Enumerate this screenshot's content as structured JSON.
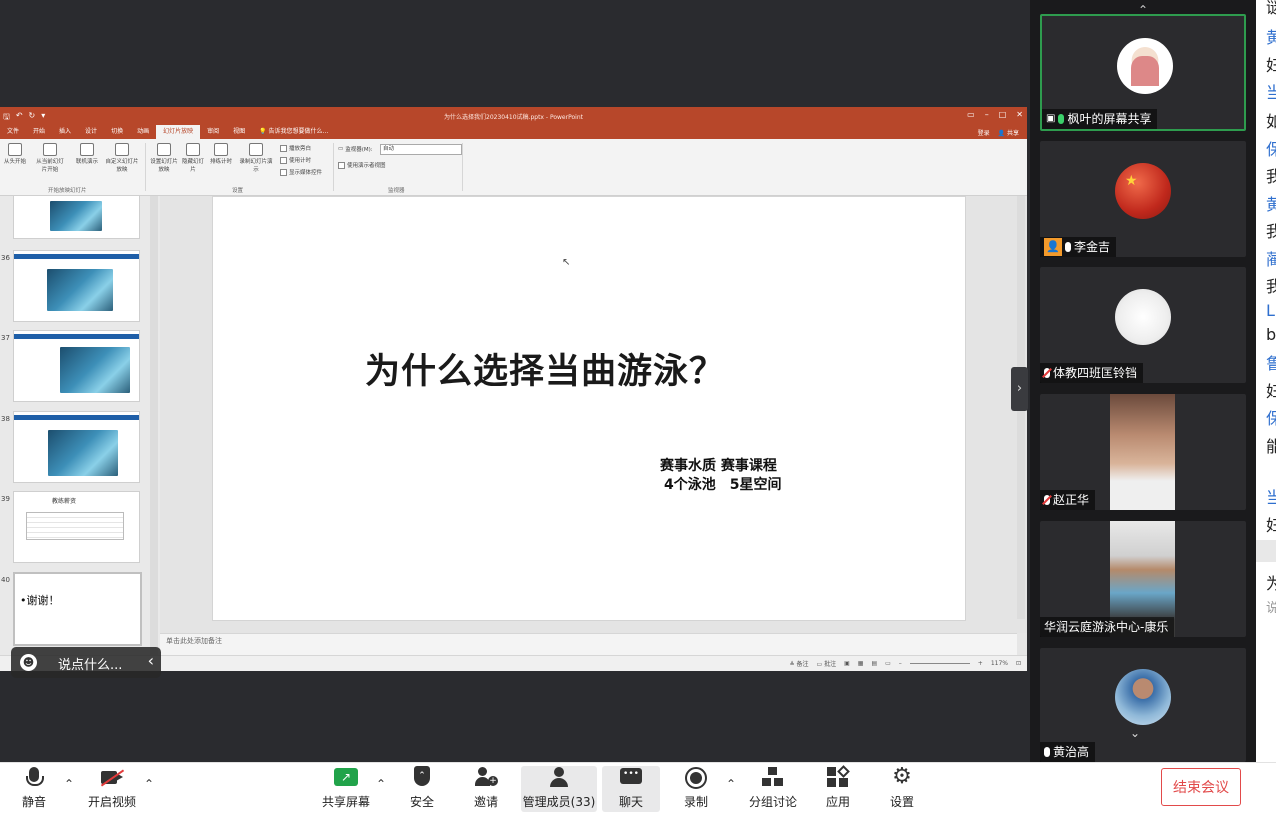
{
  "ppt": {
    "title_bar": "为什么选择我们20230410试稿.pptx - PowerPoint",
    "tabs": [
      "文件",
      "开始",
      "插入",
      "设计",
      "切换",
      "动画",
      "幻灯片放映",
      "审阅",
      "视图"
    ],
    "search_hint": "告诉我您想要做什么...",
    "login": "登录",
    "share": "共享",
    "ribbon": {
      "btn_from_start": "从头开始",
      "btn_from_current": "从当前幻灯片开始",
      "btn_online": "联机演示",
      "btn_custom": "自定义幻灯片放映",
      "group_start": "开始放映幻灯片",
      "btn_setup": "设置幻灯片放映",
      "btn_hide": "隐藏幻灯片",
      "btn_rehearse": "排练计时",
      "btn_record": "录制幻灯片演示",
      "chk_narration": "播放旁白",
      "chk_timing": "使用计时",
      "chk_media": "显示媒体控件",
      "group_setup": "设置",
      "monitor_label": "监视器(M):",
      "monitor_value": "自动",
      "chk_presenter": "使用演示者视图",
      "group_monitor": "监视器"
    },
    "thumbnails": [
      {
        "num": "36",
        "band": "专业游泳教学中心"
      },
      {
        "num": "37",
        "band": "专业游泳教学中心"
      },
      {
        "num": "38",
        "band": "专业游泳教学中心"
      },
      {
        "num": "39",
        "title": "教练薪资"
      },
      {
        "num": "40",
        "text": "•谢谢！"
      }
    ],
    "slide": {
      "title": "为什么选择当曲游泳？",
      "sub1": "赛事水质 赛事课程",
      "sub2": "4个泳池　5星空间"
    },
    "notes_placeholder": "单击此处添加备注",
    "status": {
      "notes": "备注",
      "comments": "批注",
      "zoom": "117%"
    }
  },
  "chat_hint": "说点什么...",
  "participants": [
    {
      "name": "枫叶的屏幕共享",
      "mic": "on",
      "active": true
    },
    {
      "name": "李金吉",
      "mic": "normal"
    },
    {
      "name": "体教四班匡铃铛",
      "mic": "off"
    },
    {
      "name": "赵正华",
      "mic": "off"
    },
    {
      "name": "华润云庭游泳中心-康乐",
      "mic": "none"
    },
    {
      "name": "黄治高",
      "mic": "normal"
    }
  ],
  "chat_column_chars": [
    "谜",
    "黄",
    "妇",
    "当",
    "如",
    "保",
    "我",
    "黄",
    "我",
    "蔺",
    "我",
    "L",
    "b",
    "鲁",
    "妇",
    "保",
    "能",
    "",
    "当",
    "妇",
    "",
    "为",
    "说"
  ],
  "toolbar": {
    "mute": "静音",
    "video": "开启视频",
    "share": "共享屏幕",
    "security": "安全",
    "invite": "邀请",
    "members": "管理成员(33)",
    "chat": "聊天",
    "record": "录制",
    "breakout": "分组讨论",
    "apps": "应用",
    "settings": "设置",
    "end": "结束会议"
  },
  "colors": {
    "ppt_accent": "#b7472a",
    "active_border": "#2e9c4e",
    "end_red": "#e24a4a"
  }
}
